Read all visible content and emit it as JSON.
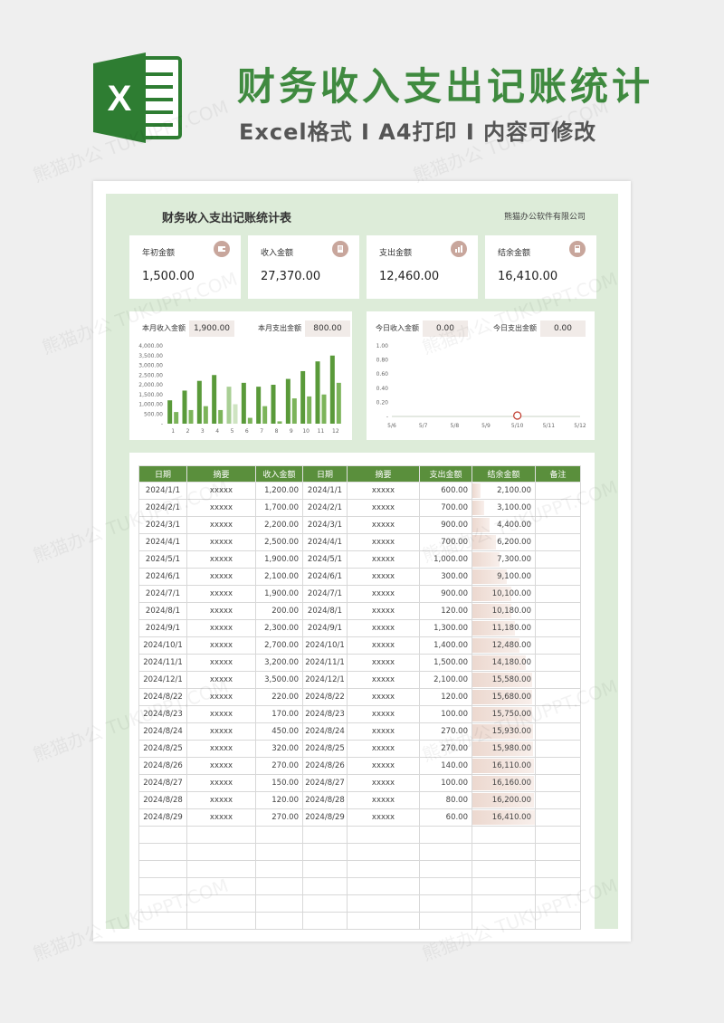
{
  "header": {
    "title": "财务收入支出记账统计",
    "subtitle": "Excel格式 I A4打印 I 内容可修改",
    "logo_letter": "X",
    "brand_color": "#3f8a3f"
  },
  "sheet": {
    "title": "财务收入支出记账统计表",
    "company": "熊猫办公软件有限公司",
    "cards": [
      {
        "label": "年初金额",
        "value": "1,500.00",
        "icon": "wallet-icon"
      },
      {
        "label": "收入金额",
        "value": "27,370.00",
        "icon": "document-icon"
      },
      {
        "label": "支出金额",
        "value": "12,460.00",
        "icon": "chart-icon"
      },
      {
        "label": "结余金额",
        "value": "16,410.00",
        "icon": "calculator-icon"
      }
    ],
    "month_income_label": "本月收入金额",
    "month_income_value": "1,900.00",
    "month_expense_label": "本月支出金额",
    "month_expense_value": "800.00",
    "today_income_label": "今日收入金额",
    "today_income_value": "0.00",
    "today_expense_label": "今日支出金额",
    "today_expense_value": "0.00"
  },
  "chart_data": [
    {
      "type": "bar",
      "categories": [
        "1",
        "2",
        "3",
        "4",
        "5",
        "6",
        "7",
        "8",
        "9",
        "10",
        "11",
        "12"
      ],
      "series": [
        {
          "values": [
            1200,
            1700,
            2200,
            2500,
            1900,
            2100,
            1900,
            2000,
            2300,
            2700,
            3200,
            3500
          ],
          "color": "#5a9a3a"
        },
        {
          "values": [
            600,
            700,
            900,
            700,
            1000,
            300,
            900,
            120,
            1300,
            1400,
            1500,
            2100
          ],
          "color": "#7cb45a"
        }
      ],
      "highlight_index": 5,
      "y_ticks": [
        "4,000.00",
        "3,500.00",
        "3,000.00",
        "2,500.00",
        "2,000.00",
        "1,500.00",
        "1,000.00",
        "500.00",
        "-"
      ],
      "ylim": [
        0,
        4000
      ]
    },
    {
      "type": "line",
      "x": [
        "5/6",
        "5/7",
        "5/8",
        "5/9",
        "5/10",
        "5/11",
        "5/12"
      ],
      "values": [
        0,
        0,
        0,
        0,
        0,
        0,
        0
      ],
      "marker_index": 4,
      "y_ticks": [
        "1.00",
        "0.80",
        "0.60",
        "0.40",
        "0.20",
        "-"
      ],
      "ylim": [
        0,
        1
      ]
    }
  ],
  "table": {
    "headers": [
      "日期",
      "摘要",
      "收入金额",
      "日期",
      "摘要",
      "支出金额",
      "结余金额",
      "备注"
    ],
    "rows": [
      [
        "2024/1/1",
        "xxxxx",
        "1,200.00",
        "2024/1/1",
        "xxxxx",
        "600.00",
        "2,100.00",
        ""
      ],
      [
        "2024/2/1",
        "xxxxx",
        "1,700.00",
        "2024/2/1",
        "xxxxx",
        "700.00",
        "3,100.00",
        ""
      ],
      [
        "2024/3/1",
        "xxxxx",
        "2,200.00",
        "2024/3/1",
        "xxxxx",
        "900.00",
        "4,400.00",
        ""
      ],
      [
        "2024/4/1",
        "xxxxx",
        "2,500.00",
        "2024/4/1",
        "xxxxx",
        "700.00",
        "6,200.00",
        ""
      ],
      [
        "2024/5/1",
        "xxxxx",
        "1,900.00",
        "2024/5/1",
        "xxxxx",
        "1,000.00",
        "7,300.00",
        ""
      ],
      [
        "2024/6/1",
        "xxxxx",
        "2,100.00",
        "2024/6/1",
        "xxxxx",
        "300.00",
        "9,100.00",
        ""
      ],
      [
        "2024/7/1",
        "xxxxx",
        "1,900.00",
        "2024/7/1",
        "xxxxx",
        "900.00",
        "10,100.00",
        ""
      ],
      [
        "2024/8/1",
        "xxxxx",
        "200.00",
        "2024/8/1",
        "xxxxx",
        "120.00",
        "10,180.00",
        ""
      ],
      [
        "2024/9/1",
        "xxxxx",
        "2,300.00",
        "2024/9/1",
        "xxxxx",
        "1,300.00",
        "11,180.00",
        ""
      ],
      [
        "2024/10/1",
        "xxxxx",
        "2,700.00",
        "2024/10/1",
        "xxxxx",
        "1,400.00",
        "12,480.00",
        ""
      ],
      [
        "2024/11/1",
        "xxxxx",
        "3,200.00",
        "2024/11/1",
        "xxxxx",
        "1,500.00",
        "14,180.00",
        ""
      ],
      [
        "2024/12/1",
        "xxxxx",
        "3,500.00",
        "2024/12/1",
        "xxxxx",
        "2,100.00",
        "15,580.00",
        ""
      ],
      [
        "2024/8/22",
        "xxxxx",
        "220.00",
        "2024/8/22",
        "xxxxx",
        "120.00",
        "15,680.00",
        ""
      ],
      [
        "2024/8/23",
        "xxxxx",
        "170.00",
        "2024/8/23",
        "xxxxx",
        "100.00",
        "15,750.00",
        ""
      ],
      [
        "2024/8/24",
        "xxxxx",
        "450.00",
        "2024/8/24",
        "xxxxx",
        "270.00",
        "15,930.00",
        ""
      ],
      [
        "2024/8/25",
        "xxxxx",
        "320.00",
        "2024/8/25",
        "xxxxx",
        "270.00",
        "15,980.00",
        ""
      ],
      [
        "2024/8/26",
        "xxxxx",
        "270.00",
        "2024/8/26",
        "xxxxx",
        "140.00",
        "16,110.00",
        ""
      ],
      [
        "2024/8/27",
        "xxxxx",
        "150.00",
        "2024/8/27",
        "xxxxx",
        "100.00",
        "16,160.00",
        ""
      ],
      [
        "2024/8/28",
        "xxxxx",
        "120.00",
        "2024/8/28",
        "xxxxx",
        "80.00",
        "16,200.00",
        ""
      ],
      [
        "2024/8/29",
        "xxxxx",
        "270.00",
        "2024/8/29",
        "xxxxx",
        "60.00",
        "16,410.00",
        ""
      ],
      [
        "",
        "",
        "",
        "",
        "",
        "",
        "",
        ""
      ],
      [
        "",
        "",
        "",
        "",
        "",
        "",
        "",
        ""
      ],
      [
        "",
        "",
        "",
        "",
        "",
        "",
        "",
        ""
      ],
      [
        "",
        "",
        "",
        "",
        "",
        "",
        "",
        ""
      ],
      [
        "",
        "",
        "",
        "",
        "",
        "",
        "",
        ""
      ],
      [
        "",
        "",
        "",
        "",
        "",
        "",
        "",
        ""
      ]
    ],
    "balance_fill": [
      0.13,
      0.19,
      0.27,
      0.38,
      0.44,
      0.55,
      0.62,
      0.62,
      0.68,
      0.76,
      0.86,
      0.95,
      0.96,
      0.96,
      0.97,
      0.97,
      0.98,
      0.98,
      0.99,
      1.0
    ]
  },
  "watermark": "熊猫办公 TUKUPPT.COM"
}
